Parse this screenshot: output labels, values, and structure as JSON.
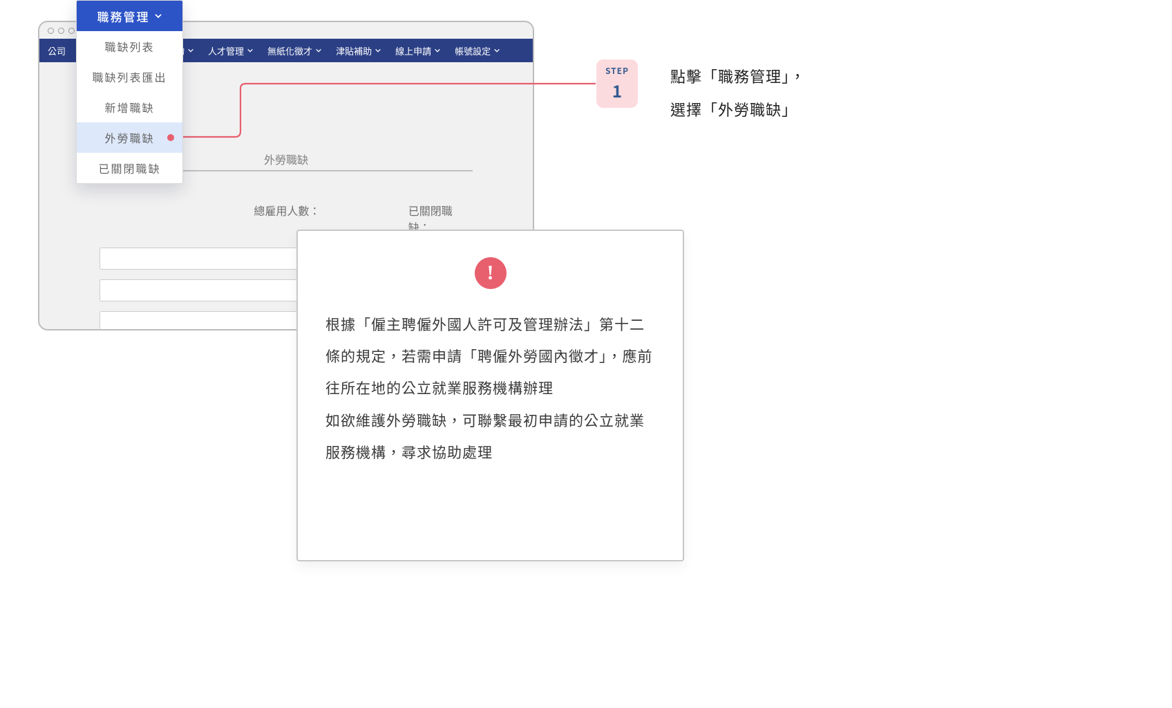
{
  "nav": {
    "items": [
      {
        "label": "公司",
        "chevron": false
      },
      {
        "label": "查詢",
        "chevron": true
      },
      {
        "label": "人才管理",
        "chevron": true
      },
      {
        "label": "無紙化徵才",
        "chevron": true
      },
      {
        "label": "津貼補助",
        "chevron": true
      },
      {
        "label": "線上申請",
        "chevron": true
      },
      {
        "label": "帳號設定",
        "chevron": true
      }
    ]
  },
  "dropdown": {
    "header_label": "職務管理",
    "items": [
      {
        "label": "職缺列表",
        "highlight": false
      },
      {
        "label": "職缺列表匯出",
        "highlight": false
      },
      {
        "label": "新增職缺",
        "highlight": false
      },
      {
        "label": "外勞職缺",
        "highlight": true
      },
      {
        "label": "已關閉職缺",
        "highlight": false
      }
    ]
  },
  "page": {
    "tab_selected_label": "外勞職缺",
    "stat1": "",
    "stat2": "總雇用人數：",
    "stat3": "已關閉職缺："
  },
  "modal": {
    "icon_glyph": "!",
    "body": "根據「僱主聘僱外國人許可及管理辦法」第十二條的規定，若需申請「聘僱外勞國內徵才」，應前往所在地的公立就業服務機構辦理\n如欲維護外勞職缺，可聯繫最初申請的公立就業服務機構，尋求協助處理"
  },
  "step": {
    "word": "STEP",
    "num": "1"
  },
  "caption": {
    "line1": "點擊「職務管理」，",
    "line2": "選擇「外勞職缺」"
  },
  "colors": {
    "accent_blue": "#2d54c7",
    "accent_rose": "#e85f6e"
  }
}
